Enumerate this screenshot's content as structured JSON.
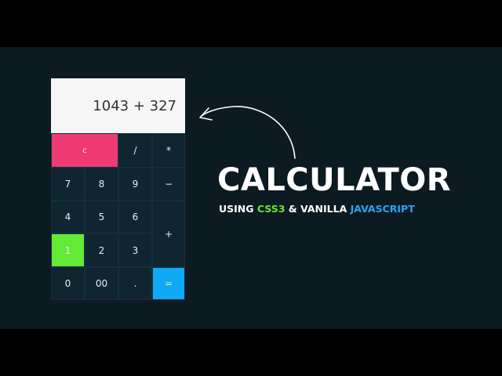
{
  "display": {
    "expression": "1043 + 327"
  },
  "keys": {
    "clear": "c",
    "divide": "/",
    "multiply": "*",
    "seven": "7",
    "eight": "8",
    "nine": "9",
    "minus": "−",
    "four": "4",
    "five": "5",
    "six": "6",
    "plus": "+",
    "one": "1",
    "two": "2",
    "three": "3",
    "zero": "0",
    "double_zero": "00",
    "dot": ".",
    "equals": "="
  },
  "headline": {
    "title": "CALCULATOR",
    "sub_prefix": "USING ",
    "sub_css": "CSS3",
    "sub_middle": " & VANILLA ",
    "sub_js": "JAVASCRIPT"
  },
  "colors": {
    "background": "#0c1a22",
    "key_clear": "#ef3b74",
    "key_one": "#63ea36",
    "key_equals": "#10a9f6",
    "accent_css": "#63ea36",
    "accent_js": "#26a6f0"
  },
  "icons": [
    "curved-arrow-icon"
  ]
}
